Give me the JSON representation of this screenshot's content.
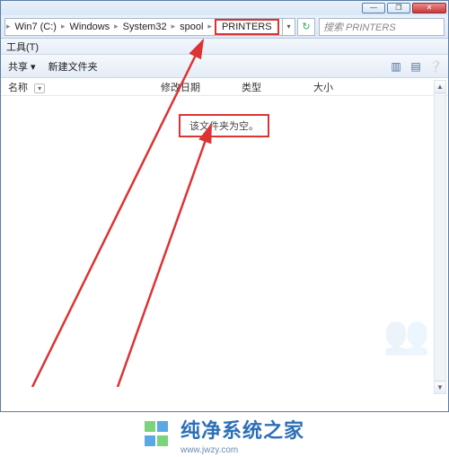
{
  "titlebar": {
    "min": "—",
    "max": "❐",
    "close": "✕"
  },
  "breadcrumbs": {
    "sep": "▸",
    "items": [
      "Win7 (C:)",
      "Windows",
      "System32",
      "spool",
      "PRINTERS"
    ],
    "dropdown": "▾",
    "refresh": "↻"
  },
  "search": {
    "placeholder": "搜索 PRINTERS"
  },
  "menubar": {
    "tools": "工具(T)"
  },
  "toolbar": {
    "share": "共享 ▾",
    "newfolder": "新建文件夹",
    "icons": {
      "view": "▥",
      "preview": "▤",
      "help": "❔"
    }
  },
  "columns": {
    "name": "名称",
    "date": "修改日期",
    "type": "类型",
    "size": "大小",
    "sort": "▾"
  },
  "content": {
    "empty": "该文件夹为空。"
  },
  "branding": {
    "name": "纯净系统之家",
    "url": "www.jwzy.com"
  }
}
